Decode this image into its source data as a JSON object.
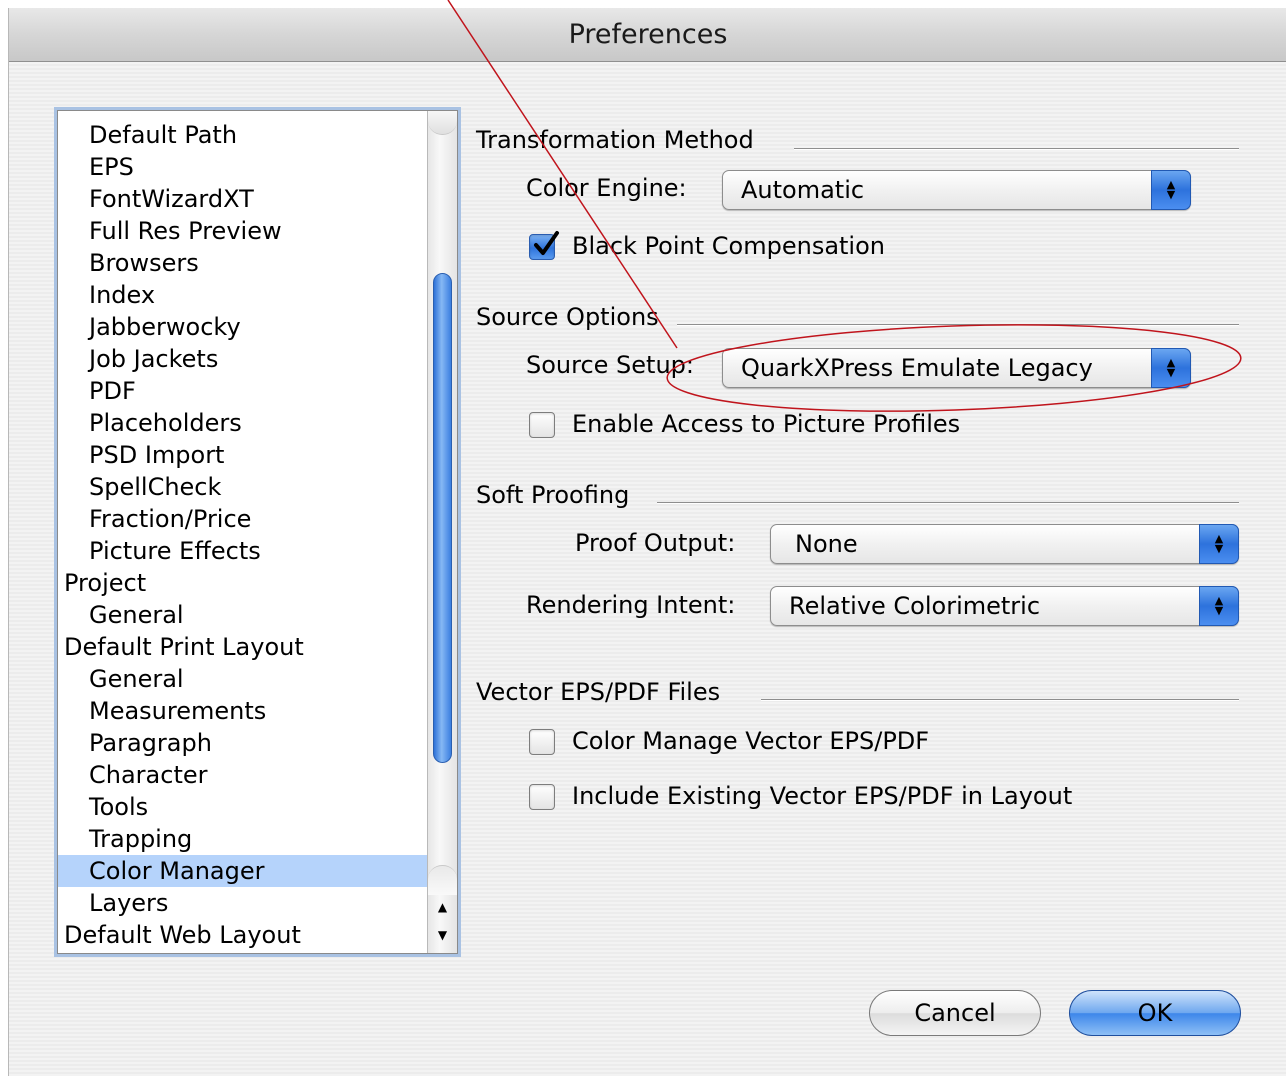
{
  "window": {
    "title": "Preferences"
  },
  "sidebar": {
    "items": [
      {
        "label": "Default Path",
        "level": 1
      },
      {
        "label": "EPS",
        "level": 1
      },
      {
        "label": "FontWizardXT",
        "level": 1
      },
      {
        "label": "Full Res Preview",
        "level": 1
      },
      {
        "label": "Browsers",
        "level": 1
      },
      {
        "label": "Index",
        "level": 1
      },
      {
        "label": "Jabberwocky",
        "level": 1
      },
      {
        "label": "Job Jackets",
        "level": 1
      },
      {
        "label": "PDF",
        "level": 1
      },
      {
        "label": "Placeholders",
        "level": 1
      },
      {
        "label": "PSD Import",
        "level": 1
      },
      {
        "label": "SpellCheck",
        "level": 1
      },
      {
        "label": "Fraction/Price",
        "level": 1
      },
      {
        "label": "Picture Effects",
        "level": 1
      },
      {
        "label": "Project",
        "level": 0
      },
      {
        "label": "General",
        "level": 1
      },
      {
        "label": "Default Print Layout",
        "level": 0
      },
      {
        "label": "General",
        "level": 1
      },
      {
        "label": "Measurements",
        "level": 1
      },
      {
        "label": "Paragraph",
        "level": 1
      },
      {
        "label": "Character",
        "level": 1
      },
      {
        "label": "Tools",
        "level": 1
      },
      {
        "label": "Trapping",
        "level": 1
      },
      {
        "label": "Color Manager",
        "level": 1,
        "selected": true
      },
      {
        "label": "Layers",
        "level": 1
      },
      {
        "label": "Default Web Layout",
        "level": 0
      }
    ]
  },
  "transformation": {
    "title": "Transformation Method",
    "color_engine_label": "Color Engine:",
    "color_engine_value": "Automatic",
    "black_point_label": "Black Point Compensation",
    "black_point_checked": true
  },
  "source": {
    "title": "Source Options",
    "setup_label": "Source Setup:",
    "setup_value": "QuarkXPress Emulate Legacy",
    "profiles_label": "Enable Access to Picture Profiles",
    "profiles_checked": false
  },
  "proofing": {
    "title": "Soft Proofing",
    "output_label": "Proof Output:",
    "output_value": "None",
    "intent_label": "Rendering Intent:",
    "intent_value": "Relative Colorimetric"
  },
  "vector": {
    "title": "Vector EPS/PDF Files",
    "manage_label": "Color Manage Vector EPS/PDF",
    "manage_checked": false,
    "include_label": "Include Existing Vector EPS/PDF in Layout",
    "include_checked": false
  },
  "buttons": {
    "cancel": "Cancel",
    "ok": "OK"
  },
  "colors": {
    "accent": "#3d86ea",
    "selection": "#b5d3fb",
    "annotation": "#c0141c"
  }
}
